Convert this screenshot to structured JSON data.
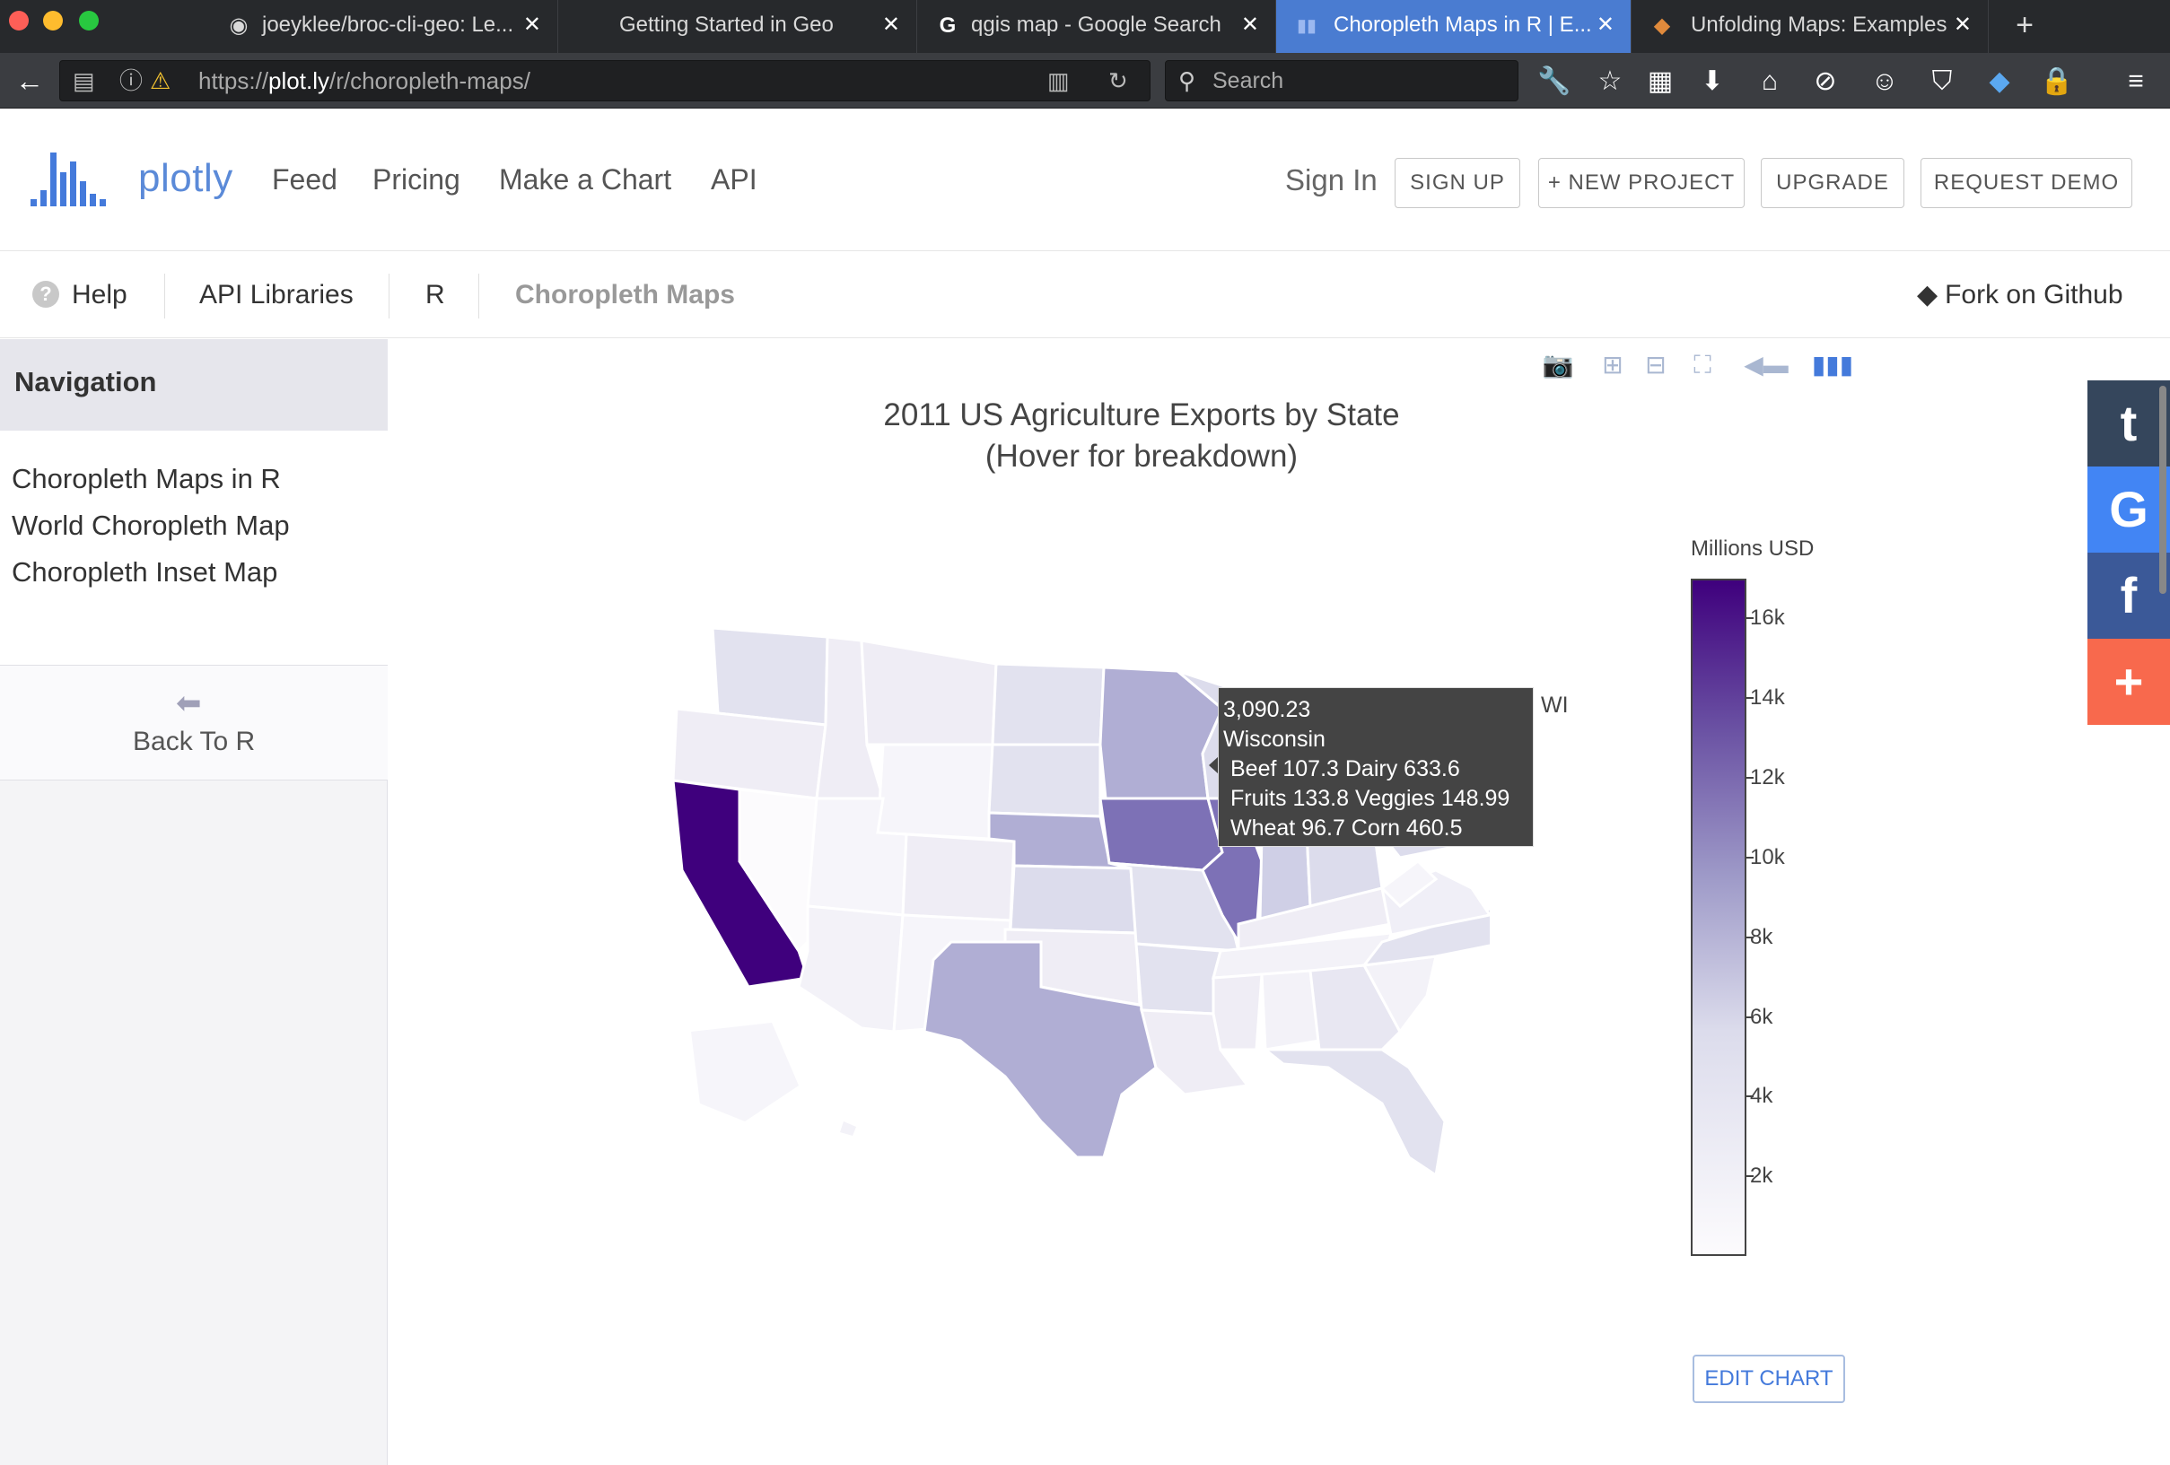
{
  "browser": {
    "tabs": [
      {
        "title": "joeyklee/broc-cli-geo: Le...",
        "icon": "github-icon"
      },
      {
        "title": "Getting Started in Geo",
        "icon": "none"
      },
      {
        "title": "qgis map - Google Search",
        "icon": "google-icon"
      },
      {
        "title": "Choropleth Maps in R | E...",
        "icon": "plotly-icon",
        "active": true
      },
      {
        "title": "Unfolding Maps: Examples",
        "icon": "unfolding-icon"
      }
    ],
    "url_prefix": "https://",
    "url_host": "plot.ly",
    "url_path": "/r/choropleth-maps/",
    "search_placeholder": "Search"
  },
  "header": {
    "logo_text": "plotly",
    "nav": [
      "Feed",
      "Pricing",
      "Make a Chart",
      "API"
    ],
    "signin": "Sign In",
    "buttons": [
      "SIGN UP",
      "+ NEW PROJECT",
      "UPGRADE",
      "REQUEST DEMO"
    ]
  },
  "breadcrumb": {
    "help": "Help",
    "items": [
      "API Libraries",
      "R",
      "Choropleth Maps"
    ],
    "fork": "Fork on Github"
  },
  "sidebar": {
    "heading": "Navigation",
    "links": [
      "Choropleth Maps in R",
      "World Choropleth Map",
      "Choropleth Inset Map"
    ],
    "back": "Back To R"
  },
  "chart_data": {
    "type": "choropleth",
    "title": "2011 US Agriculture Exports by State",
    "subtitle": "(Hover for breakdown)",
    "colorbar": {
      "title": "Millions USD",
      "ticks": [
        "16k",
        "14k",
        "12k",
        "10k",
        "8k",
        "6k",
        "4k",
        "2k"
      ],
      "tick_values": [
        16000,
        14000,
        12000,
        10000,
        8000,
        6000,
        4000,
        2000
      ],
      "range": [
        0,
        17000
      ],
      "colorscale": [
        "#fcfbfd",
        "#dcdcec",
        "#9e9ac8",
        "#6a51a3",
        "#3f007d"
      ]
    },
    "hover": {
      "state_abbr": "WI",
      "value": "3,090.23",
      "state": "Wisconsin",
      "line1": "Beef 107.3 Dairy 633.6",
      "line2": "Fruits 133.8 Veggies 148.99",
      "line3": "Wheat 96.7 Corn 460.5"
    }
  },
  "edit_chart": "EDIT CHART",
  "social": [
    "t",
    "G",
    "f",
    "+"
  ],
  "colors": {
    "accent": "#447adb",
    "tab_active": "#4a7cd1",
    "tumblr": "#35465c",
    "google": "#4285f4",
    "facebook": "#3b5998",
    "addthis": "#f8694d"
  }
}
